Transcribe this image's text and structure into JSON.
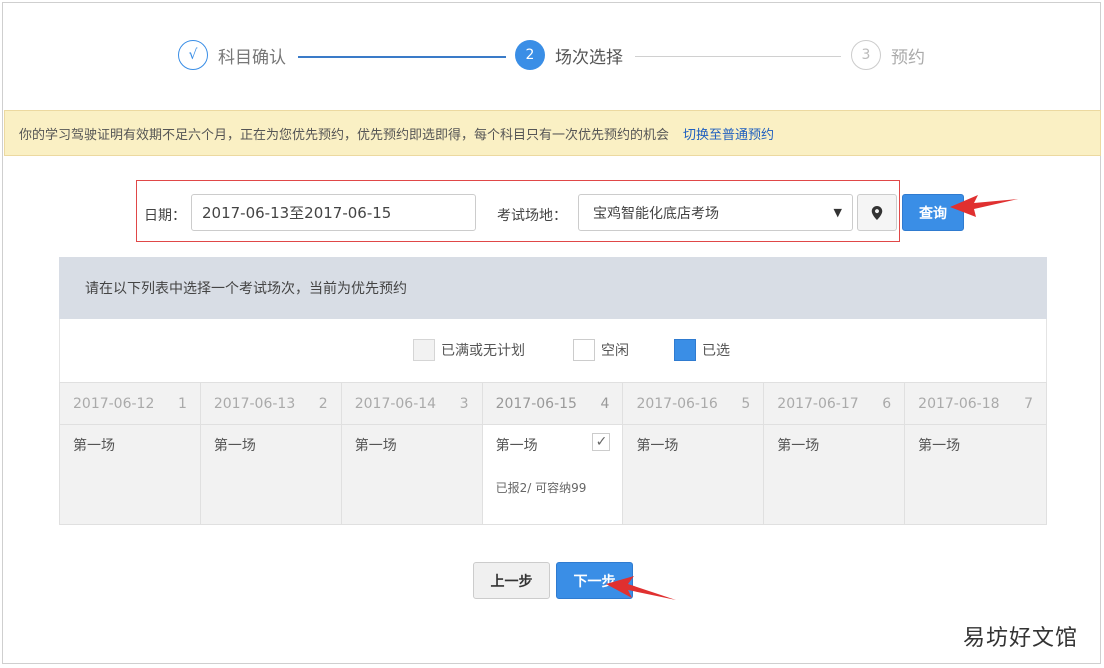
{
  "stepper": {
    "steps": [
      {
        "marker": "√",
        "label": "科目确认"
      },
      {
        "marker": "2",
        "label": "场次选择"
      },
      {
        "marker": "3",
        "label": "预约"
      }
    ]
  },
  "notice": {
    "text": "你的学习驾驶证明有效期不足六个月，正在为您优先预约，优先预约即选即得，每个科目只有一次优先预约的机会",
    "link": "切换至普通预约"
  },
  "filter": {
    "date_label": "日期：",
    "date_value": "2017-06-13至2017-06-15",
    "venue_label": "考试场地：",
    "venue_value": "宝鸡智能化底店考场",
    "location_icon": "map-marker-icon",
    "query_label": "查询"
  },
  "table": {
    "heading": "请在以下列表中选择一个考试场次，当前为优先预约",
    "legend": {
      "full": "已满或无计划",
      "free": "空闲",
      "selected": "已选"
    },
    "days": [
      {
        "date": "2017-06-12",
        "num": "1",
        "session": "第一场",
        "selected": false
      },
      {
        "date": "2017-06-13",
        "num": "2",
        "session": "第一场",
        "selected": false
      },
      {
        "date": "2017-06-14",
        "num": "3",
        "session": "第一场",
        "selected": false
      },
      {
        "date": "2017-06-15",
        "num": "4",
        "session": "第一场",
        "selected": true,
        "capacity": "已报2/ 可容纳99"
      },
      {
        "date": "2017-06-16",
        "num": "5",
        "session": "第一场",
        "selected": false
      },
      {
        "date": "2017-06-17",
        "num": "6",
        "session": "第一场",
        "selected": false
      },
      {
        "date": "2017-06-18",
        "num": "7",
        "session": "第一场",
        "selected": false
      }
    ]
  },
  "actions": {
    "prev_label": "上一步",
    "next_label": "下一步"
  },
  "watermark": "易坊好文馆",
  "colors": {
    "accent": "#3a8ee6",
    "notice_bg": "#faf0c4",
    "arrow": "#e03030",
    "highlight_border": "#e04848"
  }
}
